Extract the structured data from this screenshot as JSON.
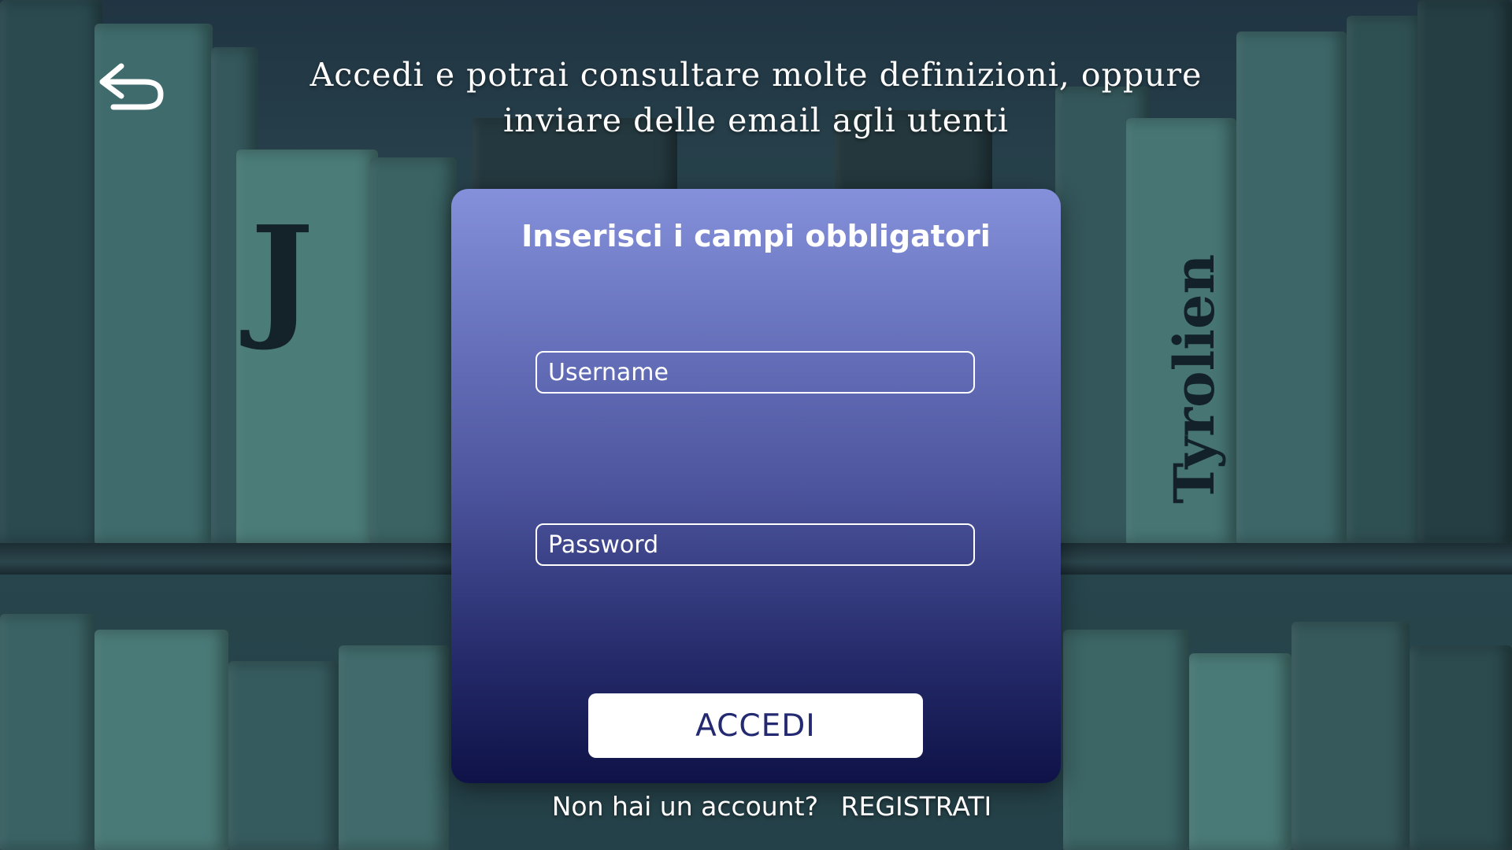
{
  "header": {
    "back_icon": "back-arrow-icon",
    "headline": "Accedi e potrai consultare molte definizioni, oppure inviare delle email agli utenti"
  },
  "login_card": {
    "title": "Inserisci i campi obbligatori",
    "username_placeholder": "Username",
    "password_placeholder": "Password",
    "submit_label": "ACCEDI"
  },
  "footer": {
    "prompt": "Non hai un account?",
    "register_label": "REGISTRATI"
  },
  "background": {
    "spine_texts": [
      "Tyrolien",
      "J"
    ]
  },
  "colors": {
    "card_top": "#8590db",
    "card_bottom": "#0e1247",
    "button_text": "#232a72",
    "background": "#2d4d54"
  }
}
